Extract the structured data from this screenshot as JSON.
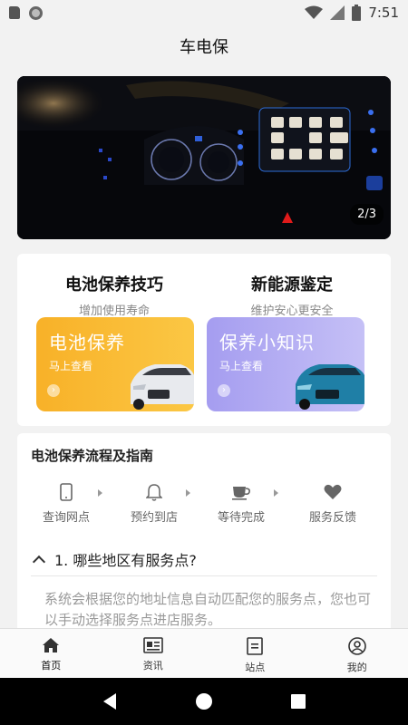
{
  "status_bar": {
    "time": "7:51",
    "icons": [
      "sd-card-icon",
      "circle-app-icon",
      "wifi-icon",
      "cell-signal-icon",
      "battery-icon"
    ]
  },
  "header": {
    "title": "车电保"
  },
  "banner": {
    "counter": "2/3"
  },
  "promos": [
    {
      "title": "电池保养技巧",
      "subtitle": "增加使用寿命",
      "tile_title": "电池保养",
      "tile_link": "马上查看"
    },
    {
      "title": "新能源鉴定",
      "subtitle": "维护安心更安全",
      "tile_title": "保养小知识",
      "tile_link": "马上查看"
    }
  ],
  "guide": {
    "title": "电池保养流程及指南",
    "steps": [
      {
        "label": "查询网点",
        "icon": "phone-icon"
      },
      {
        "label": "预约到店",
        "icon": "bell-icon"
      },
      {
        "label": "等待完成",
        "icon": "coffee-cup-icon"
      },
      {
        "label": "服务反馈",
        "icon": "heart-icon"
      }
    ],
    "faq": {
      "question": "1. 哪些地区有服务点?",
      "answer": "系统会根据您的地址信息自动匹配您的服务点，您也可以手动选择服务点进店服务。"
    }
  },
  "tabs": [
    {
      "label": "首页",
      "icon": "home-icon",
      "active": true
    },
    {
      "label": "资讯",
      "icon": "news-icon",
      "active": false
    },
    {
      "label": "站点",
      "icon": "station-icon",
      "active": false
    },
    {
      "label": "我的",
      "icon": "user-icon",
      "active": false
    }
  ],
  "colors": {
    "accent": "#333333",
    "tile_orange": "#f7a51e",
    "tile_purple": "#9d96ee"
  }
}
